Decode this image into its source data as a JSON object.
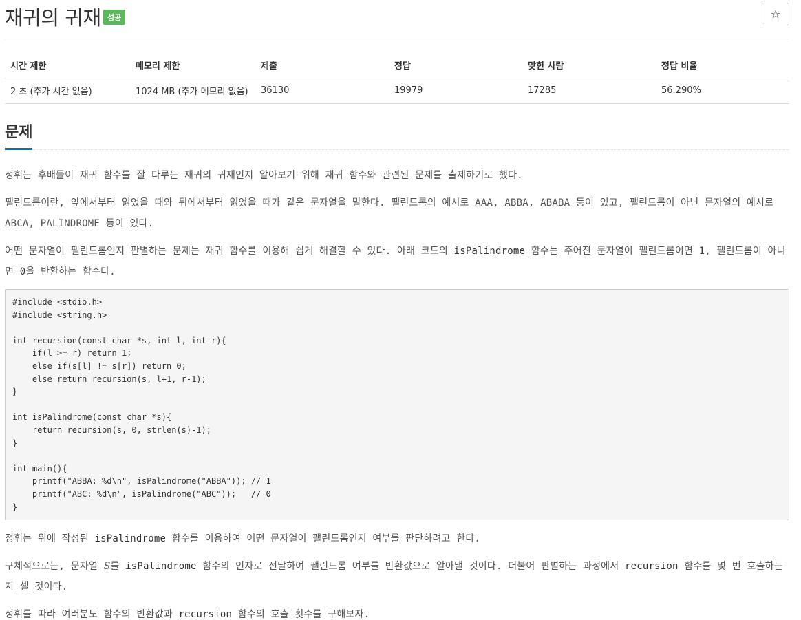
{
  "header": {
    "title": "재귀의 귀재",
    "badge": "성공",
    "star_icon": "☆"
  },
  "stats": {
    "columns": [
      "시간 제한",
      "메모리 제한",
      "제출",
      "정답",
      "맞힌 사람",
      "정답 비율"
    ],
    "values": [
      "2 초 (추가 시간 없음)",
      "1024 MB (추가 메모리 없음)",
      "36130",
      "19979",
      "17285",
      "56.290%"
    ]
  },
  "section": {
    "title": "문제"
  },
  "problem": {
    "p1": "정휘는 후배들이 재귀 함수를 잘 다루는 재귀의 귀재인지 알아보기 위해 재귀 함수와 관련된 문제를 출제하기로 했다.",
    "p2": "팰린드롬이란, 앞에서부터 읽었을 때와 뒤에서부터 읽었을 때가 같은 문자열을 말한다. 팰린드롬의 예시로 AAA, ABBA, ABABA 등이 있고, 팰린드롬이 아닌 문자열의 예시로 ABCA, PALINDROME 등이 있다.",
    "p3a": "어떤 문자열이 팰린드롬인지 판별하는 문제는 재귀 함수를 이용해 쉽게 해결할 수 있다. 아래 코드의 ",
    "p3_code1": "isPalindrome",
    "p3b": " 함수는 주어진 문자열이 팰린드롬이면 ",
    "p3_code2": "1",
    "p3c": ", 팰린드롬이 아니면 ",
    "p3_code3": "0",
    "p3d": "을 반환하는 함수다.",
    "code": "#include <stdio.h>\n#include <string.h>\n\nint recursion(const char *s, int l, int r){\n    if(l >= r) return 1;\n    else if(s[l] != s[r]) return 0;\n    else return recursion(s, l+1, r-1);\n}\n\nint isPalindrome(const char *s){\n    return recursion(s, 0, strlen(s)-1);\n}\n\nint main(){\n    printf(\"ABBA: %d\\n\", isPalindrome(\"ABBA\")); // 1\n    printf(\"ABC: %d\\n\", isPalindrome(\"ABC\"));   // 0\n}",
    "p4a": "정휘는 위에 작성된 ",
    "p4_code": "isPalindrome",
    "p4b": " 함수를 이용하여 어떤 문자열이 팰린드롬인지 여부를 판단하려고 한다.",
    "p5a": "구체적으로는, 문자열 ",
    "p5_math": "S",
    "p5b": "를 ",
    "p5_code1": "isPalindrome",
    "p5c": " 함수의 인자로 전달하여 팰린드롬 여부를 반환값으로 알아낼 것이다. 더불어 판별하는 과정에서 ",
    "p5_code2": "recursion",
    "p5d": " 함수를 몇 번 호출하는지 셀 것이다.",
    "p6a": "정휘를 따라 여러분도 함수의 반환값과 ",
    "p6_code": "recursion",
    "p6b": " 함수의 호출 횟수를 구해보자."
  }
}
